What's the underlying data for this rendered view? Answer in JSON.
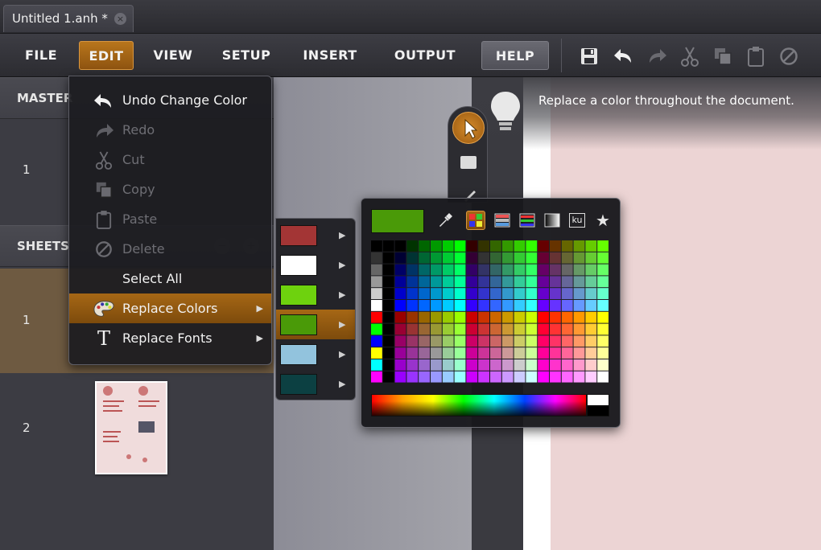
{
  "tab": {
    "title": "Untitled 1.anh *",
    "close_glyph": "×"
  },
  "menubar": {
    "items": [
      {
        "label": "FILE"
      },
      {
        "label": "EDIT"
      },
      {
        "label": "VIEW"
      },
      {
        "label": "SETUP"
      },
      {
        "label": "INSERT"
      },
      {
        "label": "OUTPUT"
      },
      {
        "label": "HELP"
      }
    ],
    "active": "EDIT",
    "toolbar_icons": [
      "save-icon",
      "undo-icon",
      "redo-icon",
      "cut-icon",
      "copy-icon",
      "paste-icon",
      "delete-icon"
    ]
  },
  "leftpanel": {
    "masters_label": "MASTER",
    "master_row_num": "1",
    "sheets_label": "SHEETS",
    "sheet_rows": [
      "1",
      "2"
    ],
    "minus_glyph": "−",
    "plus_glyph": "+"
  },
  "edit_menu": {
    "items": [
      {
        "label": "Undo Change Color",
        "icon": "undo-icon",
        "enabled": true
      },
      {
        "label": "Redo",
        "icon": "redo-icon",
        "enabled": false
      },
      {
        "label": "Cut",
        "icon": "scissors-icon",
        "enabled": false
      },
      {
        "label": "Copy",
        "icon": "copy-icon",
        "enabled": false
      },
      {
        "label": "Paste",
        "icon": "clipboard-icon",
        "enabled": false
      },
      {
        "label": "Delete",
        "icon": "delete-icon",
        "enabled": false
      },
      {
        "label": "Select All",
        "icon": "",
        "enabled": true
      },
      {
        "label": "Replace Colors",
        "icon": "palette-icon",
        "enabled": true,
        "highlighted": true,
        "submenu": true
      },
      {
        "label": "Replace Fonts",
        "icon": "font-icon",
        "enabled": true,
        "submenu": true
      }
    ],
    "font_icon_glyph": "T",
    "arrow_glyph": "▶"
  },
  "swatches": {
    "colors": [
      "#a33535",
      "#ffffff",
      "#6ed20e",
      "#4a9a08",
      "#92c3dd",
      "#0c4042"
    ],
    "highlighted_index": 3
  },
  "picker": {
    "current_color": "#4a9a08",
    "icons": [
      "eyedropper-icon",
      "swatch-grid-icon",
      "gradient-swatches-icon",
      "rgb-sliders-icon",
      "grayscale-icon",
      "kuler-icon",
      "favorites-star-icon"
    ],
    "kuler_text": "ku",
    "star_glyph": "★"
  },
  "canvas": {
    "hint": "Replace a color throughout the document."
  }
}
